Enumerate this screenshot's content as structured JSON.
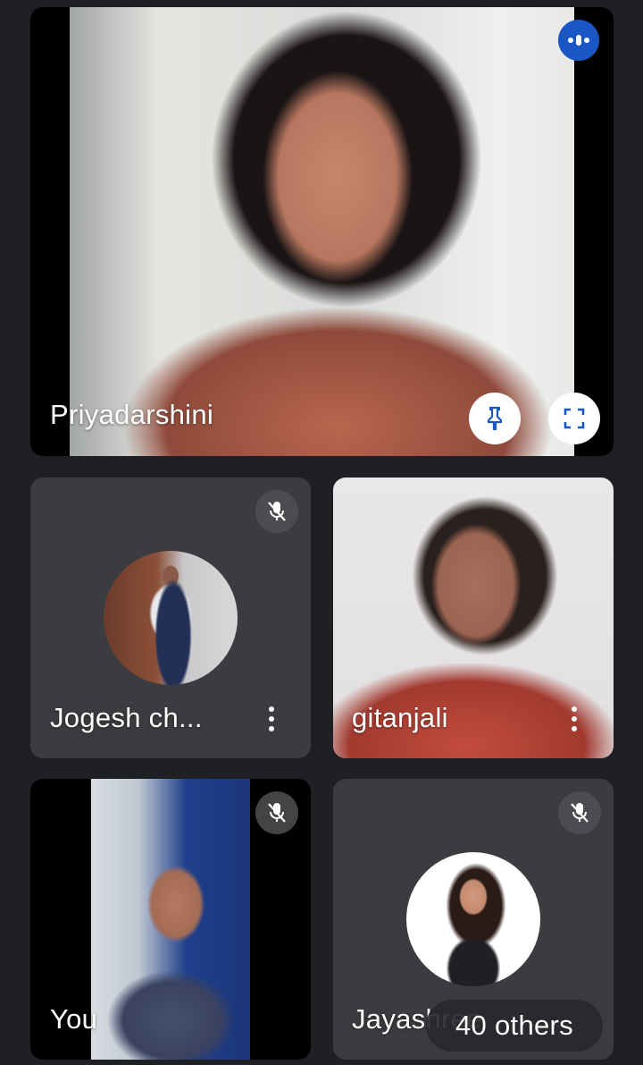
{
  "participants": {
    "main": {
      "name": "Priyadarshini"
    },
    "jogesh": {
      "name": "Jogesh ch..."
    },
    "gitanjali": {
      "name": "gitanjali"
    },
    "you": {
      "name": "You"
    },
    "jaya": {
      "name": "Jayashree"
    }
  },
  "others": {
    "label": "40 others"
  },
  "colors": {
    "background": "#1f2023",
    "tile": "#3b3c3f",
    "speaking_accent": "#1a57c5"
  },
  "icons": {
    "speaking": "audio-activity-icon",
    "pin": "pin-icon",
    "fullscreen": "fullscreen-icon",
    "muted": "mic-off-icon",
    "more": "more-vert-icon"
  }
}
